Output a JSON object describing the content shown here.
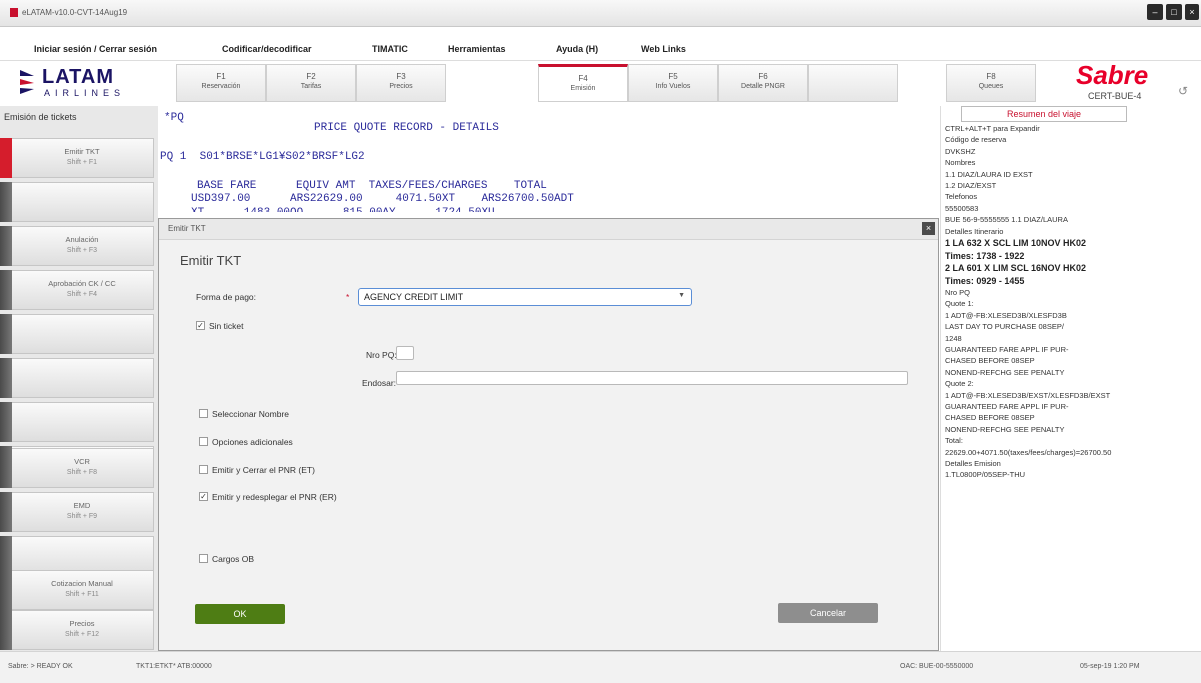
{
  "window": {
    "title": "eLATAM-v10.0-CVT-14Aug19"
  },
  "menu": [
    {
      "label": "Iniciar sesión / Cerrar sesión"
    },
    {
      "label": "Codificar/decodificar"
    },
    {
      "label": "TIMATIC"
    },
    {
      "label": "Herramientas"
    },
    {
      "label": "Ayuda (H)"
    },
    {
      "label": "Web Links"
    }
  ],
  "brand": {
    "latam": "LATAM",
    "airlines": "AIRLINES",
    "sabre": "Sabre",
    "cert": "CERT-BUE-4"
  },
  "ftabs": [
    {
      "key": "F1",
      "label": "Reservación"
    },
    {
      "key": "F2",
      "label": "Tarifas"
    },
    {
      "key": "F3",
      "label": "Precios"
    },
    {
      "key": "F4",
      "label": "Emisión"
    },
    {
      "key": "F5",
      "label": "Info Vuelos"
    },
    {
      "key": "F6",
      "label": "Detalle PNGR"
    },
    {
      "key": "",
      "label": ""
    },
    {
      "key": "F8",
      "label": "Queues"
    }
  ],
  "sidebar": {
    "header": "Emisión de tickets",
    "items": [
      {
        "label": "Emitir TKT",
        "shortcut": "Shift + F1"
      },
      {
        "label": "",
        "shortcut": ""
      },
      {
        "label": "Anulación",
        "shortcut": "Shift + F3"
      },
      {
        "label": "Aprobación CK / CC",
        "shortcut": "Shift + F4"
      },
      {
        "label": "",
        "shortcut": ""
      },
      {
        "label": "",
        "shortcut": ""
      },
      {
        "label": "",
        "shortcut": ""
      },
      {
        "label": "",
        "shortcut": ""
      },
      {
        "label": "VCR",
        "shortcut": "Shift + F8"
      },
      {
        "label": "EMD",
        "shortcut": "Shift + F9"
      },
      {
        "label": "",
        "shortcut": ""
      },
      {
        "label": "Cotizacion Manual",
        "shortcut": "Shift + F11"
      },
      {
        "label": "Precios",
        "shortcut": "Shift + F12"
      }
    ]
  },
  "terminal": {
    "line1": "*PQ",
    "line2": "PRICE QUOTE RECORD - DETAILS",
    "line3": "PQ 1  S01*BRSE*LG1¥S02*BRSF*LG2",
    "line4": "BASE FARE      EQUIV AMT  TAXES/FEES/CHARGES    TOTAL",
    "line5": "USD397.00      ARS22629.00     4071.50XT    ARS26700.50ADT",
    "line6": "XT      1483.00QO      815.00AY      1724.50XU"
  },
  "rpanel": {
    "header": "Resumen del viaje",
    "lines": [
      {
        "text": "CTRL+ALT+T para Expandir",
        "bold": false
      },
      {
        "text": "Código de reserva",
        "bold": false
      },
      {
        "text": "DVKSHZ",
        "bold": false
      },
      {
        "text": "Nombres",
        "bold": false
      },
      {
        "text": "1.1 DIAZ/LAURA ID EXST",
        "bold": false
      },
      {
        "text": "1.2 DIAZ/EXST",
        "bold": false
      },
      {
        "text": "Telefonos",
        "bold": false
      },
      {
        "text": "55500583",
        "bold": false
      },
      {
        "text": "BUE 56-9-5555555 1.1 DIAZ/LAURA",
        "bold": false
      },
      {
        "text": "Detalles Itinerario",
        "bold": false
      },
      {
        "text": "1 LA 632 X SCL LIM  10NOV HK02",
        "bold": true
      },
      {
        "text": "     Times: 1738 - 1922",
        "bold": true
      },
      {
        "text": "2 LA 601 X LIM SCL  16NOV HK02",
        "bold": true
      },
      {
        "text": "     Times: 0929 - 1455",
        "bold": true
      },
      {
        "text": "Nro PQ",
        "bold": false
      },
      {
        "text": "Quote 1:",
        "bold": false
      },
      {
        "text": "1 ADT@-FB:XLESED3B/XLESFD3B",
        "bold": false
      },
      {
        "text": "LAST DAY TO PURCHASE 08SEP/",
        "bold": false
      },
      {
        "text": "1248",
        "bold": false
      },
      {
        "text": "GUARANTEED FARE APPL IF PUR-",
        "bold": false
      },
      {
        "text": "CHASED BEFORE 08SEP",
        "bold": false
      },
      {
        "text": "NONEND-REFCHG SEE PENALTY",
        "bold": false
      },
      {
        "text": "Quote 2:",
        "bold": false
      },
      {
        "text": "1 ADT@-FB:XLESED3B/EXST/XLESFD3B/EXST",
        "bold": false
      },
      {
        "text": "GUARANTEED FARE APPL IF PUR-",
        "bold": false
      },
      {
        "text": "CHASED BEFORE 08SEP",
        "bold": false
      },
      {
        "text": "NONEND-REFCHG SEE PENALTY",
        "bold": false
      },
      {
        "text": "Total:",
        "bold": false
      },
      {
        "text": "22629.00+4071.50(taxes/fees/charges)=26700.50",
        "bold": false
      },
      {
        "text": "Detalles Emision",
        "bold": false
      },
      {
        "text": "1.TL0800P/05SEP-THU",
        "bold": false
      }
    ]
  },
  "dialog": {
    "title": "Emitir TKT",
    "heading": "Emitir TKT",
    "forma_label": "Forma de pago:",
    "required": "*",
    "forma_value": "AGENCY CREDIT LIMIT",
    "sin_ticket": {
      "label": "Sin ticket",
      "checked": true
    },
    "nro_pq_label": "Nro PQ:",
    "nro_pq_value": "",
    "endosar_label": "Endosar:",
    "endosar_value": "",
    "checks": [
      {
        "label": "Seleccionar Nombre",
        "checked": false
      },
      {
        "label": "Opciones adicionales",
        "checked": false
      },
      {
        "label": "Emitir y Cerrar el PNR (ET)",
        "checked": false
      },
      {
        "label": "Emitir y redesplegar el PNR (ER)",
        "checked": true
      },
      {
        "label": "Cargos OB",
        "checked": false
      }
    ],
    "ok": "OK",
    "cancel": "Cancelar"
  },
  "status": {
    "left": "Sabre: > READY OK",
    "mid": "TKT1:ETKT* ATB:00000",
    "right1": "OAC: BUE-00-5550000",
    "right2": "05-sep-19 1:20 PM"
  },
  "colors": {
    "brand_red": "#c8102e",
    "latam_blue": "#1b1464",
    "ok_green": "#4e7d14",
    "cancel_gray": "#8e8e8e"
  }
}
